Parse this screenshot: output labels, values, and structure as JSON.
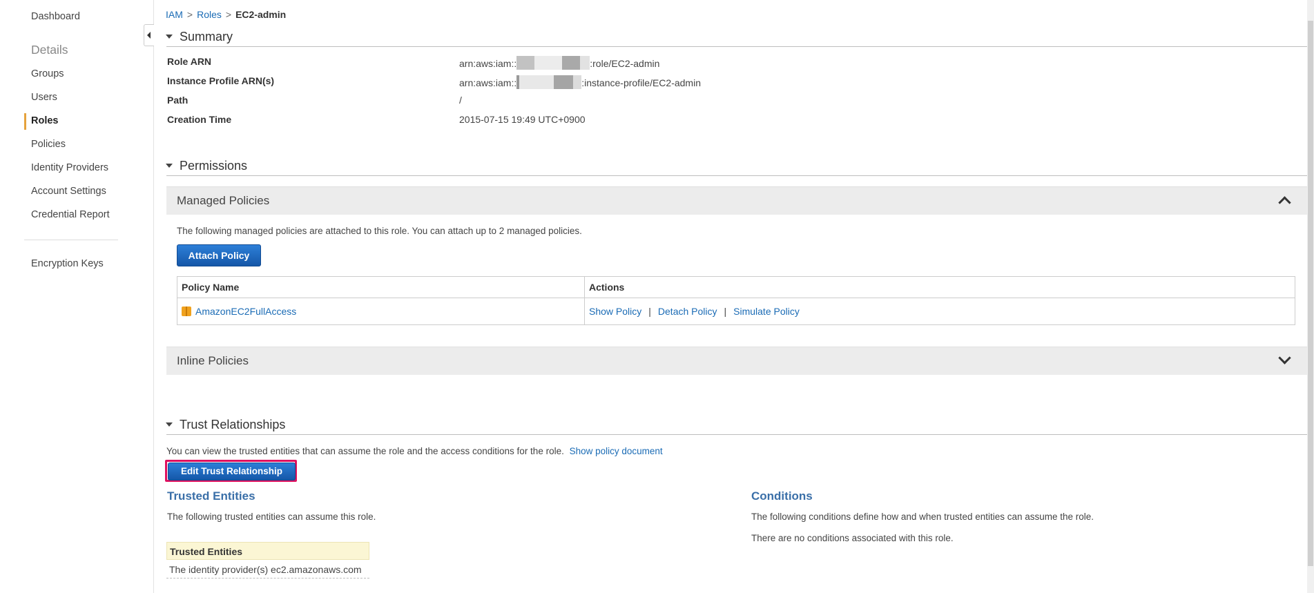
{
  "sidebar": {
    "dashboard": "Dashboard",
    "details_heading": "Details",
    "items": [
      "Groups",
      "Users",
      "Roles",
      "Policies",
      "Identity Providers",
      "Account Settings",
      "Credential Report"
    ],
    "encryption": "Encryption Keys",
    "active": "Roles"
  },
  "breadcrumb": {
    "root": "IAM",
    "parent": "Roles",
    "current": "EC2-admin",
    "separator": ">"
  },
  "summary": {
    "title": "Summary",
    "rows": [
      {
        "label": "Role ARN",
        "prefix": "arn:aws:iam::",
        "suffix": ":role/EC2-admin"
      },
      {
        "label": "Instance Profile ARN(s)",
        "prefix": "arn:aws:iam::",
        "suffix": ":instance-profile/EC2-admin"
      },
      {
        "label": "Path",
        "value": "/"
      },
      {
        "label": "Creation Time",
        "value": "2015-07-15 19:49 UTC+0900"
      }
    ]
  },
  "permissions": {
    "title": "Permissions",
    "managed": {
      "title": "Managed Policies",
      "description": "The following managed policies are attached to this role. You can attach up to 2 managed policies.",
      "attach_button": "Attach Policy",
      "columns": [
        "Policy Name",
        "Actions"
      ],
      "rows": [
        {
          "name": "AmazonEC2FullAccess",
          "actions": [
            "Show Policy",
            "Detach Policy",
            "Simulate Policy"
          ]
        }
      ],
      "separator": "|"
    },
    "inline": {
      "title": "Inline Policies"
    }
  },
  "trust": {
    "title": "Trust Relationships",
    "description": "You can view the trusted entities that can assume the role and the access conditions for the role.",
    "show_link": "Show policy document",
    "edit_button": "Edit Trust Relationship",
    "entities_heading": "Trusted Entities",
    "entities_text": "The following trusted entities can assume this role.",
    "table_header": "Trusted Entities",
    "table_row": "The identity provider(s) ec2.amazonaws.com",
    "conditions_heading": "Conditions",
    "conditions_text": "The following conditions define how and when trusted entities can assume the role.",
    "conditions_none": "There are no conditions associated with this role."
  },
  "colors": {
    "link": "#1a6bb5",
    "button": "#1f6bc4",
    "highlight": "#e0115f",
    "active_bar": "#e6a23c"
  }
}
